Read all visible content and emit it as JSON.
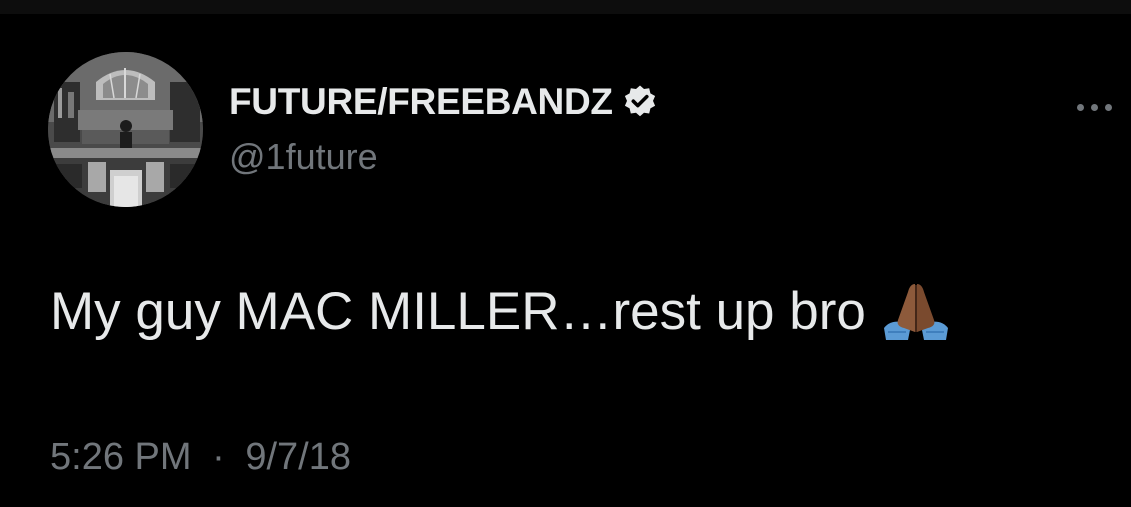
{
  "tweet": {
    "display_name": "FUTURE/FREEBANDZ",
    "handle": "@1future",
    "text": "My guy MAC MILLER…rest up bro",
    "time": "5:26 PM",
    "separator": "·",
    "date": "9/7/18"
  },
  "icons": {
    "avatar": "courtroom-photo-avatar",
    "verified": "verified-badge-icon",
    "more": "more-options-icon",
    "emoji": "folded-hands-emoji"
  },
  "colors": {
    "background": "#000000",
    "primary_text": "#e7e9ea",
    "secondary_text": "#71767b",
    "verified_badge": "#e7e9ea"
  }
}
